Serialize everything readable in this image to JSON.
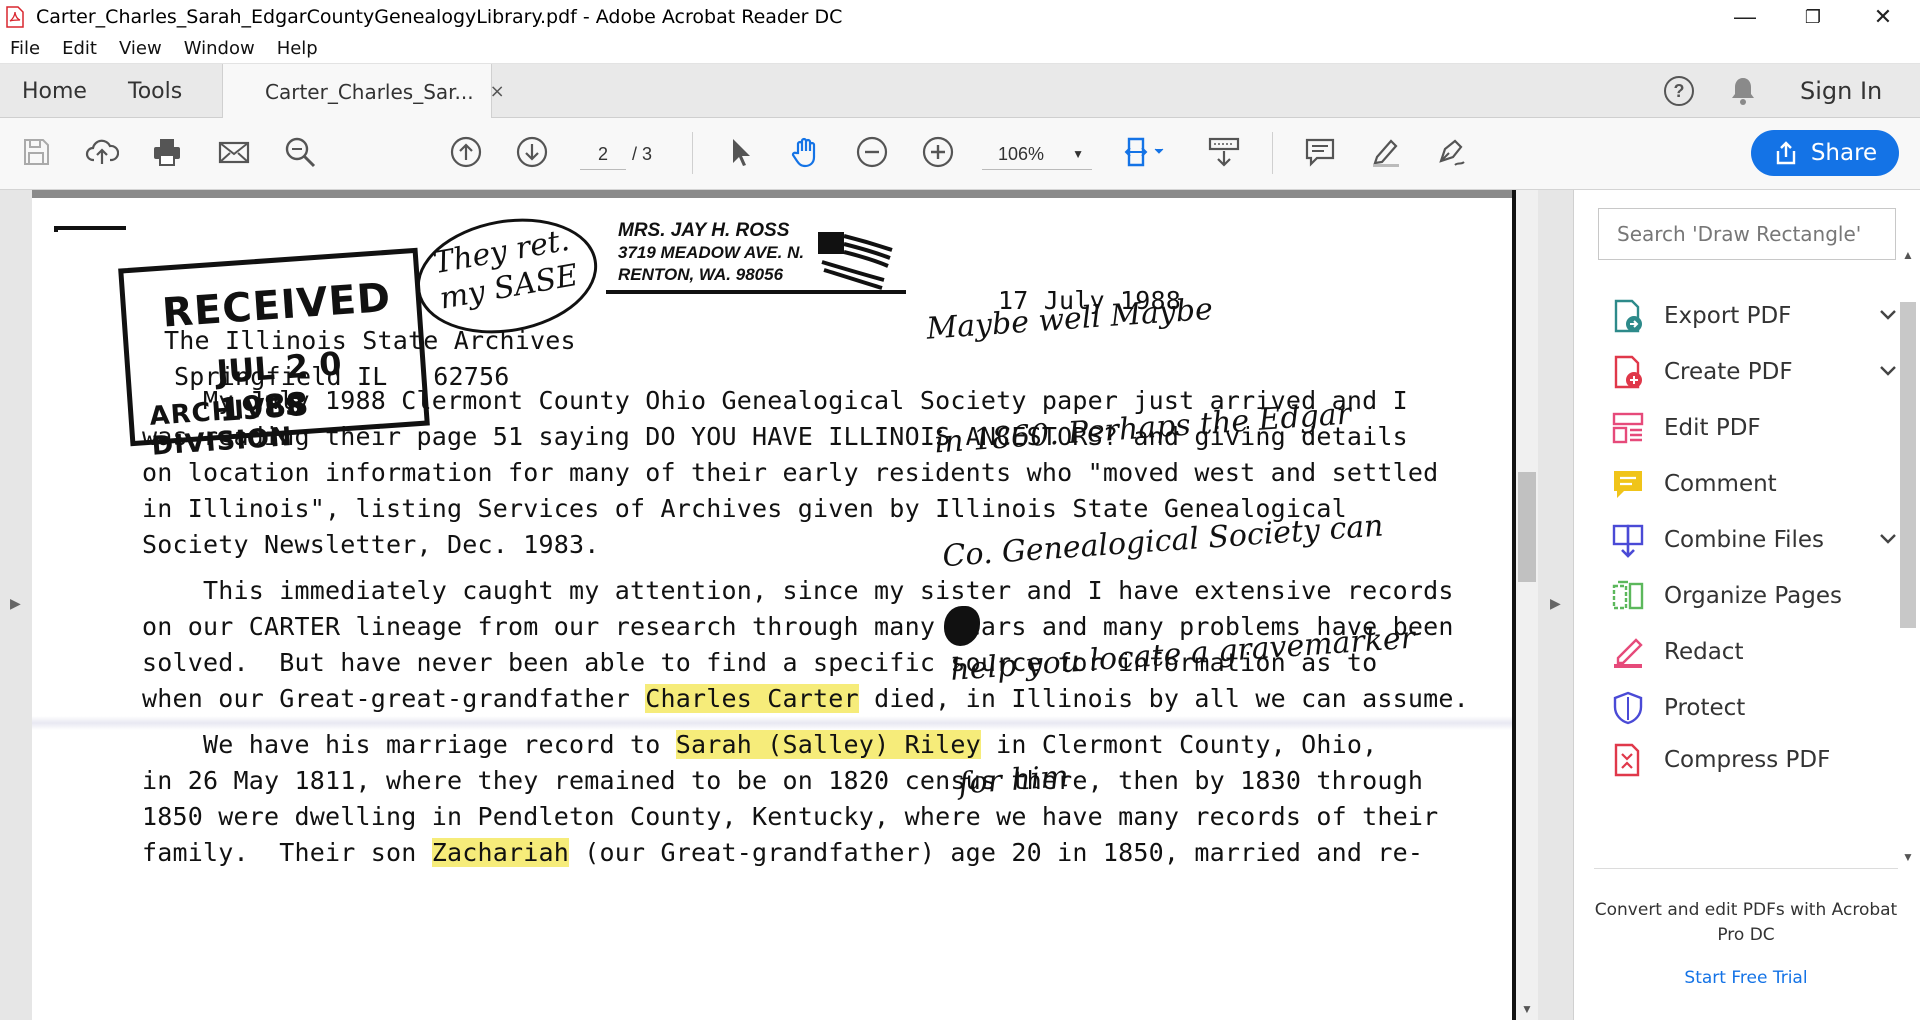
{
  "window": {
    "title": "Carter_Charles_Sarah_EdgarCountyGenealogyLibrary.pdf - Adobe Acrobat Reader DC",
    "minimize": "—",
    "restore": "❐",
    "close": "✕"
  },
  "menu": [
    "File",
    "Edit",
    "View",
    "Window",
    "Help"
  ],
  "tabs": {
    "home": "Home",
    "tools": "Tools",
    "document": "Carter_Charles_Sar...",
    "close": "×",
    "help": "?",
    "sign_in": "Sign In"
  },
  "toolbar": {
    "page_current": "2",
    "page_total": "/ 3",
    "zoom": "106%",
    "zoom_caret": "▼",
    "share": "Share"
  },
  "colors": {
    "accent": "#1473e6",
    "highlight": "#f6ec7a"
  },
  "document": {
    "stamp": {
      "received": "RECEIVED",
      "date": "JUL 2 0 1988",
      "division": "ARCHIVES DIVISION"
    },
    "handwriting_top": "They ret.\nmy SASE",
    "return_address": [
      "MRS. JAY H. ROSS",
      "3719 MEADOW AVE. N.",
      "RENTON, WA. 98056"
    ],
    "date_line": "17 July 1988",
    "recipient": [
      "The Illinois State Archives",
      "Springfield IL   62756"
    ],
    "handwriting_note": [
      "Maybe well Maybe",
      "in 1860. Perhaps the Edgar",
      "Co. Genealogical Society can",
      "help you locate a gravemarker",
      "for him"
    ],
    "para1": [
      "    My July 1988 Clermont County Ohio Genealogical Society paper just arrived and I",
      "was reading their page 51 saying DO YOU HAVE ILLINOIS ANCESTORS? and giving details",
      "on location information for many of their early residents who \"moved west and settled",
      "in Illinois\", listing Services of Archives given by Illinois State Genealogical",
      "Society Newsletter, Dec. 1983."
    ],
    "para2": [
      "    This immediately caught my attention, since my sister and I have extensive records",
      "on our CARTER lineage from our research through many years and many problems have been",
      "solved.  But have never been able to find a specific source for information as to"
    ],
    "para2_last": {
      "before": "when our Great-great-grandfather ",
      "highlight": "Charles Carter",
      "after": " died, in Illinois by all we can assume."
    },
    "para3_first": {
      "before": "    We have his marriage record to ",
      "highlight": "Sarah (Salley) Riley",
      "after": " in Clermont County, Ohio,"
    },
    "para3": [
      "in 26 May 1811, where they remained to be on 1820 census there, then by 1830 through",
      "1850 were dwelling in Pendleton County, Kentucky, where we have many records of their"
    ],
    "para3_last": {
      "before": "family.  Their son ",
      "highlight": "Zachariah",
      "after": " (our Great-grandfather) age 20 in 1850, married and re-"
    }
  },
  "right_panel": {
    "search_placeholder": "Search 'Draw Rectangle'",
    "tools": [
      {
        "label": "Export PDF",
        "icon": "export-pdf-icon",
        "color": "#2d8a8a",
        "expand": true
      },
      {
        "label": "Create PDF",
        "icon": "create-pdf-icon",
        "color": "#e0384a",
        "expand": true
      },
      {
        "label": "Edit PDF",
        "icon": "edit-pdf-icon",
        "color": "#e64a7a",
        "expand": false
      },
      {
        "label": "Comment",
        "icon": "comment-icon",
        "color": "#f0c419",
        "expand": false
      },
      {
        "label": "Combine Files",
        "icon": "combine-files-icon",
        "color": "#4a4ad6",
        "expand": true
      },
      {
        "label": "Organize Pages",
        "icon": "organize-pages-icon",
        "color": "#5cb85c",
        "expand": false
      },
      {
        "label": "Redact",
        "icon": "redact-icon",
        "color": "#e64a7a",
        "expand": false
      },
      {
        "label": "Protect",
        "icon": "protect-icon",
        "color": "#4a4ad6",
        "expand": false
      },
      {
        "label": "Compress PDF",
        "icon": "compress-pdf-icon",
        "color": "#e0384a",
        "expand": false
      }
    ],
    "promo": "Convert and edit PDFs with Acrobat Pro DC",
    "trial": "Start Free Trial"
  }
}
